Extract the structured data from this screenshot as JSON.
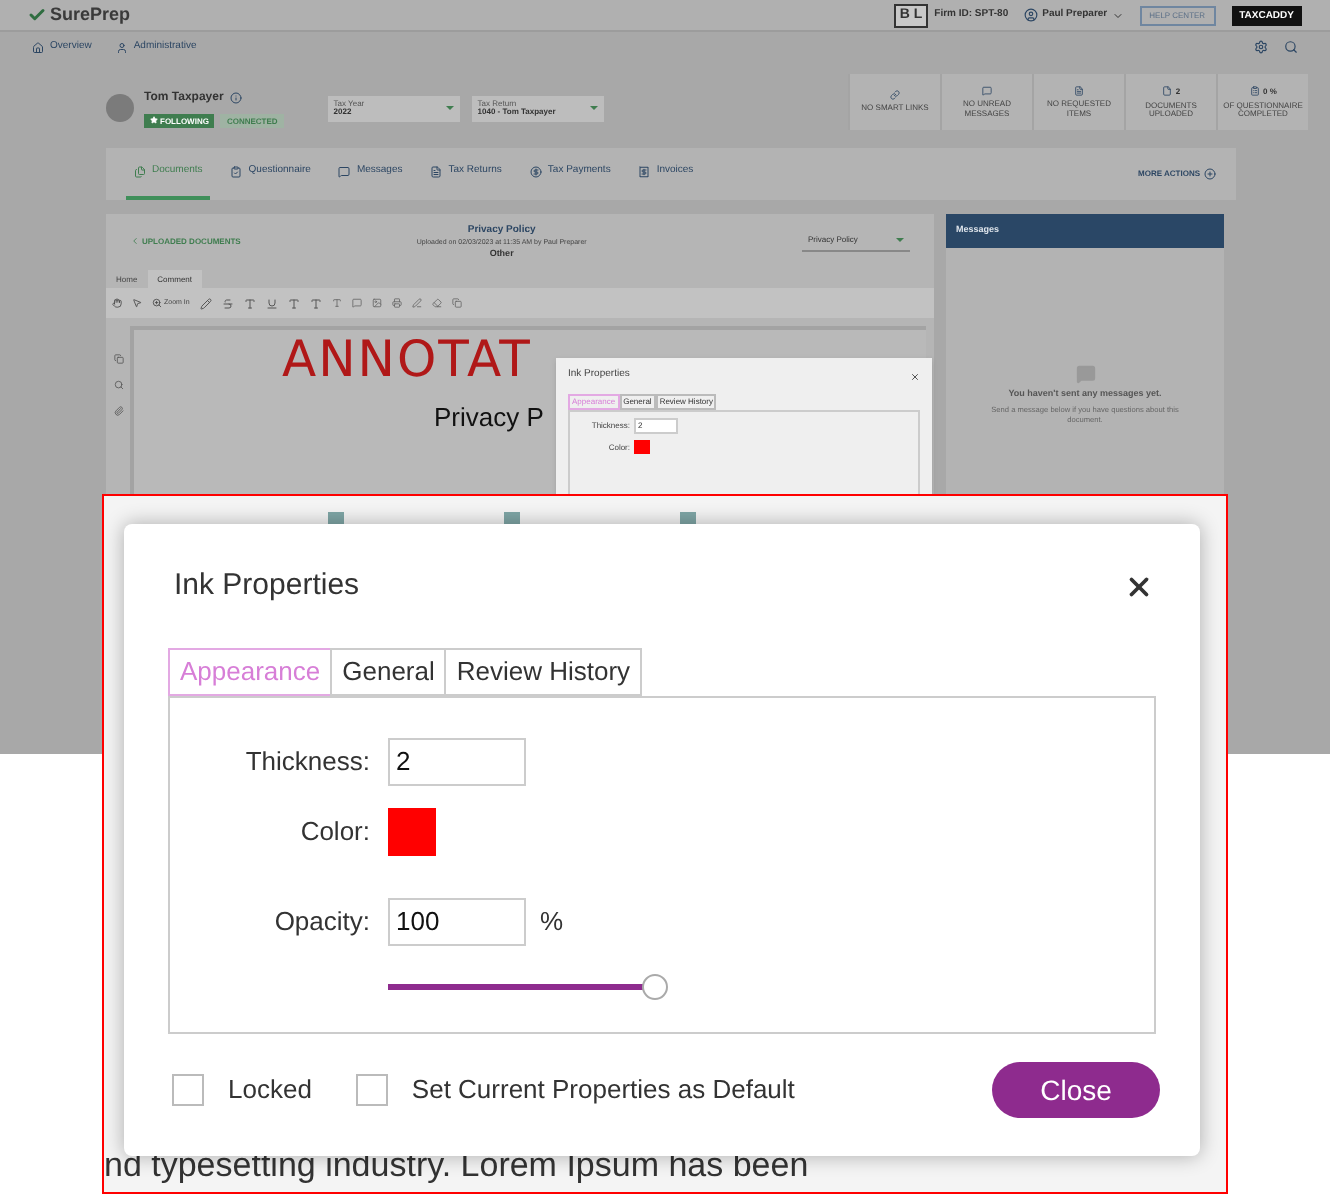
{
  "header": {
    "logo": "SurePrep",
    "firm_badge": "B L",
    "firm_id": "Firm ID: SPT-80",
    "user": "Paul Preparer",
    "help": "HELP CENTER",
    "taxcaddy": "TAXCADDY"
  },
  "nav": [
    {
      "kind": "home",
      "label": "Overview"
    },
    {
      "kind": "admin",
      "label": "Administrative"
    }
  ],
  "client": {
    "name": "Tom Taxpayer",
    "following": "FOLLOWING",
    "connected": "CONNECTED",
    "tax_year": {
      "label": "Tax Year",
      "value": "2022"
    },
    "tax_return": {
      "label": "Tax Return",
      "value": "1040 - Tom Taxpayer"
    }
  },
  "stats": [
    {
      "kind": "link",
      "label": "NO SMART LINKS"
    },
    {
      "kind": "message",
      "label": "NO UNREAD MESSAGES"
    },
    {
      "kind": "request",
      "label": "NO REQUESTED ITEMS"
    },
    {
      "kind": "documents",
      "count": "2",
      "label": "DOCUMENTS UPLOADED"
    },
    {
      "kind": "questionnaire",
      "count": "0 %",
      "label": "OF QUESTIONNAIRE COMPLETED"
    }
  ],
  "tabs": [
    {
      "kind": "documents",
      "label": "Documents",
      "selected": true
    },
    {
      "kind": "questionnaire",
      "label": "Questionnaire",
      "selected": false
    },
    {
      "kind": "messages",
      "label": "Messages",
      "selected": false
    },
    {
      "kind": "returns",
      "label": "Tax Returns",
      "selected": false
    },
    {
      "kind": "payments",
      "label": "Tax Payments",
      "selected": false
    },
    {
      "kind": "invoices",
      "label": "Invoices",
      "selected": false
    }
  ],
  "more_actions": "MORE ACTIONS",
  "document": {
    "back": "UPLOADED DOCUMENTS",
    "title": "Privacy Policy",
    "uploaded": "Uploaded on 02/03/2023 at 11:35 AM by Paul Preparer",
    "category": "Other",
    "select": "Privacy Policy",
    "viewer_tabs": [
      {
        "label": "Home",
        "selected": false
      },
      {
        "label": "Comment",
        "selected": true
      }
    ],
    "zoom": "Zoom In",
    "ink": "ANNOTAT",
    "heading": "Privacy P"
  },
  "small_dialog": {
    "title": "Ink Properties",
    "tabs": [
      {
        "label": "Appearance",
        "selected": true
      },
      {
        "label": "General",
        "selected": false
      },
      {
        "label": "Review History",
        "selected": false
      }
    ],
    "thickness_label": "Thickness:",
    "thickness": "2",
    "color_label": "Color:",
    "color": "#ff0000"
  },
  "messages": {
    "title": "Messages",
    "empty_title": "You haven't sent any messages yet.",
    "empty_text": "Send a message below if you have questions about this document."
  },
  "dialog": {
    "title": "Ink Properties",
    "tabs": [
      {
        "label": "Appearance",
        "selected": true
      },
      {
        "label": "General",
        "selected": false
      },
      {
        "label": "Review History",
        "selected": false
      }
    ],
    "thickness_label": "Thickness:",
    "thickness": "2",
    "color_label": "Color:",
    "color": "#ff0000",
    "opacity_label": "Opacity:",
    "opacity": "100",
    "opacity_unit": "%",
    "opacity_slider": {
      "level": 1
    },
    "locked": {
      "label": "Locked",
      "checked": false
    },
    "set_default": {
      "label": "Set Current Properties as Default",
      "checked": false
    },
    "close": "Close"
  },
  "page_text": "nd typesetting industry. Lorem Ipsum has been"
}
